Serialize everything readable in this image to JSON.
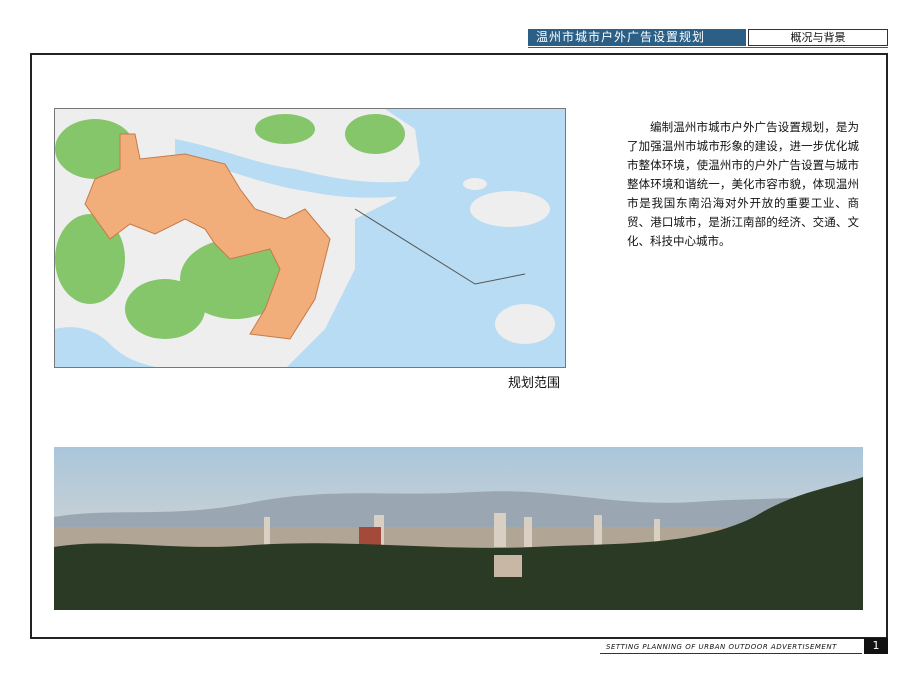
{
  "header": {
    "title": "温州市城市户外广告设置规划",
    "section": "概况与背景"
  },
  "map": {
    "caption": "规划范围",
    "colors": {
      "sea": "#b7dcf3",
      "land": "#eeeeee",
      "green": "#86c66b",
      "planning_area": "#f1ad7a",
      "river": "#b7dcf3"
    }
  },
  "intro": {
    "text": "编制温州市城市户外广告设置规划，是为了加强温州市城市形象的建设，进一步优化城市整体环境，使温州市的户外广告设置与城市整体环境和谐统一，美化市容市貌，体现温州市是我国东南沿海对外开放的重要工业、商贸、港口城市，是浙江南部的经济、交通、文化、科技中心城市。"
  },
  "footer": {
    "text": "SETTING PLANNING OF URBAN OUTDOOR ADVERTISEMENT",
    "page_number": "1"
  }
}
